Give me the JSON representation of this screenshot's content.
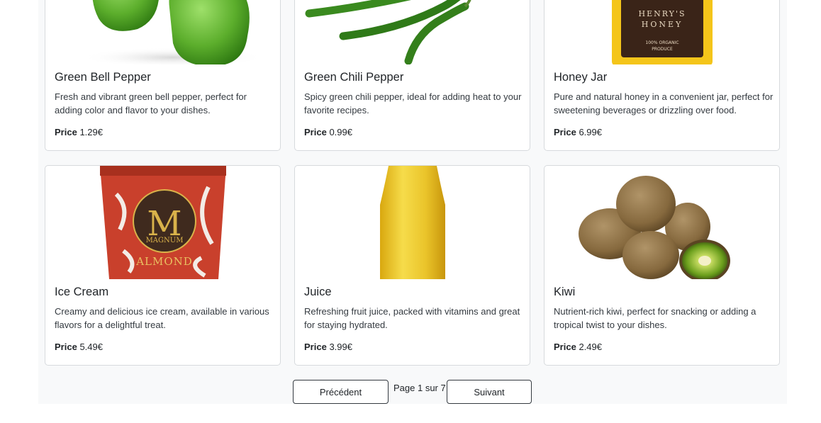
{
  "products": [
    {
      "name": "Green Bell Pepper",
      "description": "Fresh and vibrant green bell pepper, perfect for adding color and flavor to your dishes.",
      "price_label": "Price",
      "price": "1.29€",
      "image": "bell-pepper-image"
    },
    {
      "name": "Green Chili Pepper",
      "description": "Spicy green chili pepper, ideal for adding heat to your favorite recipes.",
      "price_label": "Price",
      "price": "0.99€",
      "image": "chili-pepper-image"
    },
    {
      "name": "Honey Jar",
      "description": "Pure and natural honey in a convenient jar, perfect for sweetening beverages or drizzling over food.",
      "price_label": "Price",
      "price": "6.99€",
      "image": "honey-jar-image",
      "image_text": {
        "brand_line1": "HENRY'S",
        "brand_line2": "HONEY",
        "sub1": "100% ORGANIC",
        "sub2": "PRODUCE"
      }
    },
    {
      "name": "Ice Cream",
      "description": "Creamy and delicious ice cream, available in various flavors for a delightful treat.",
      "price_label": "Price",
      "price": "5.49€",
      "image": "ice-cream-image",
      "image_text": {
        "logo_letter": "M",
        "brand": "MAGNUM",
        "flavor": "ALMOND"
      }
    },
    {
      "name": "Juice",
      "description": "Refreshing fruit juice, packed with vitamins and great for staying hydrated.",
      "price_label": "Price",
      "price": "3.99€",
      "image": "juice-bottle-image"
    },
    {
      "name": "Kiwi",
      "description": "Nutrient-rich kiwi, perfect for snacking or adding a tropical twist to your dishes.",
      "price_label": "Price",
      "price": "2.49€",
      "image": "kiwi-image"
    }
  ],
  "pagination": {
    "prev_label": "Précédent",
    "next_label": "Suivant",
    "info": "Page 1 sur 7"
  },
  "colors": {
    "page_bg": "#f8f9fa",
    "card_border": "#d7dadd",
    "text": "#212529"
  }
}
